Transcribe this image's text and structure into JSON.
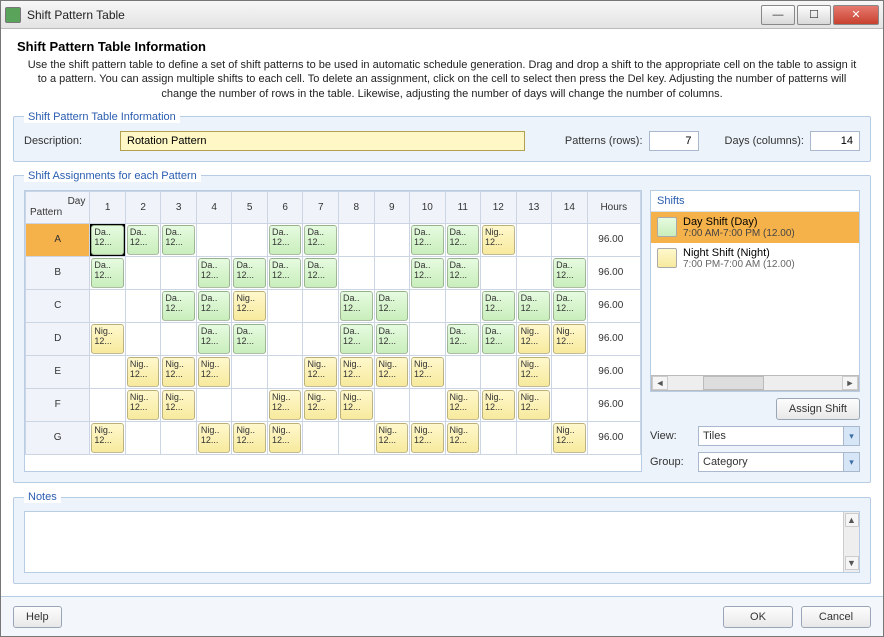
{
  "window": {
    "title": "Shift Pattern Table",
    "min": "—",
    "max": "☐",
    "close": "✕"
  },
  "heading": "Shift Pattern Table Information",
  "instructions": "Use the shift pattern table to define a set of shift patterns to be used in automatic schedule generation. Drag and drop a shift to the appropriate cell on the table to assign it to a pattern. You can assign multiple shifts to each cell. To delete an assignment, click on the cell to select then press the Del key.  Adjusting the number of patterns will change the number of rows in the table. Likewise, adjusting the number of days will change the number of columns.",
  "info_group": {
    "legend": "Shift Pattern Table Information",
    "description_label": "Description:",
    "description_value": "Rotation Pattern",
    "patterns_label": "Patterns (rows):",
    "patterns_value": "7",
    "days_label": "Days (columns):",
    "days_value": "14"
  },
  "assign_group": {
    "legend": "Shift Assignments for each Pattern",
    "corner_day": "Day",
    "corner_pattern": "Pattern",
    "day_headers": [
      "1",
      "2",
      "3",
      "4",
      "5",
      "6",
      "7",
      "8",
      "9",
      "10",
      "11",
      "12",
      "13",
      "14"
    ],
    "hours_header": "Hours",
    "rows": [
      {
        "label": "A",
        "selected": true,
        "hours": "96.00",
        "cells": [
          "D",
          "D",
          "D",
          "",
          "",
          "D",
          "D",
          "",
          "",
          "D",
          "D",
          "N",
          "",
          ""
        ]
      },
      {
        "label": "B",
        "selected": false,
        "hours": "96.00",
        "cells": [
          "D",
          "",
          "",
          "D",
          "D",
          "D",
          "D",
          "",
          "",
          "D",
          "D",
          "",
          "",
          "D"
        ]
      },
      {
        "label": "C",
        "selected": false,
        "hours": "96.00",
        "cells": [
          "",
          "",
          "D",
          "D",
          "N",
          "",
          "",
          "D",
          "D",
          "",
          "",
          "D",
          "D",
          "D"
        ]
      },
      {
        "label": "D",
        "selected": false,
        "hours": "96.00",
        "cells": [
          "N",
          "",
          "",
          "D",
          "D",
          "",
          "",
          "D",
          "D",
          "",
          "D",
          "D",
          "N",
          "N"
        ]
      },
      {
        "label": "E",
        "selected": false,
        "hours": "96.00",
        "cells": [
          "",
          "N",
          "N",
          "N",
          "",
          "",
          "N",
          "N",
          "N",
          "N",
          "",
          "",
          "N",
          ""
        ]
      },
      {
        "label": "F",
        "selected": false,
        "hours": "96.00",
        "cells": [
          "",
          "N",
          "N",
          "",
          "",
          "N",
          "N",
          "N",
          "",
          "",
          "N",
          "N",
          "N",
          ""
        ]
      },
      {
        "label": "G",
        "selected": false,
        "hours": "96.00",
        "cells": [
          "N",
          "",
          "",
          "N",
          "N",
          "N",
          "",
          "",
          "N",
          "N",
          "N",
          "",
          "",
          "N"
        ]
      }
    ],
    "chip_day": {
      "l1": "Da..",
      "l2": "12..."
    },
    "chip_night": {
      "l1": "Nig..",
      "l2": "12..."
    }
  },
  "shifts_panel": {
    "header": "Shifts",
    "items": [
      {
        "name": "Day Shift (Day)",
        "detail": "7:00 AM-7:00 PM (12.00)",
        "kind": "day",
        "selected": true
      },
      {
        "name": "Night Shift (Night)",
        "detail": "7:00 PM-7:00 AM (12.00)",
        "kind": "night",
        "selected": false
      }
    ],
    "assign_button": "Assign Shift",
    "view_label": "View:",
    "view_value": "Tiles",
    "group_label": "Group:",
    "group_value": "Category"
  },
  "notes": {
    "legend": "Notes"
  },
  "footer": {
    "help": "Help",
    "ok": "OK",
    "cancel": "Cancel"
  }
}
